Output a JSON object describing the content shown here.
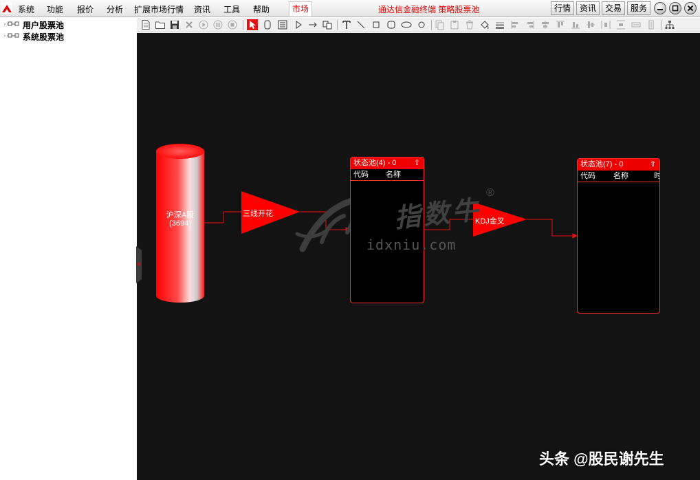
{
  "menu": {
    "items": [
      "系统",
      "功能",
      "报价",
      "分析",
      "扩展市场行情",
      "资讯",
      "工具",
      "帮助"
    ],
    "market_tab": "市场",
    "title": "通达信金融终端  策略股票池",
    "right_buttons": [
      "行情",
      "资讯",
      "交易",
      "服务"
    ]
  },
  "sidebar": {
    "tree": [
      {
        "label": "用户股票池"
      },
      {
        "label": "系统股票池"
      }
    ]
  },
  "toolbar": {
    "tools": [
      "new-file",
      "open-folder",
      "save",
      "delete",
      "play",
      "pause",
      "stop",
      "pointer",
      "capsule",
      "list",
      "triangle",
      "arrow",
      "copy",
      "text",
      "line",
      "rectangle",
      "rounded-rectangle",
      "ellipse",
      "circle",
      "copy-doc",
      "paste",
      "trash",
      "fill",
      "line-weight",
      "align-left",
      "align-right",
      "align-center-h",
      "align-top",
      "align-bottom",
      "align-middle-v",
      "distribute-h",
      "distribute-v",
      "same-width",
      "same-height",
      "tree-layout"
    ],
    "active_tool": "pointer"
  },
  "flow": {
    "source": {
      "name": "沪深A股",
      "count": "(3694)"
    },
    "filter1": {
      "label": "三线开花"
    },
    "pool1": {
      "title": "状态池(4) - 0",
      "up_icon": "arrow-up-icon",
      "columns": [
        "代码",
        "名称"
      ]
    },
    "filter2": {
      "label": "KDJ金叉"
    },
    "pool2": {
      "title": "状态池(7) - 0",
      "up_icon": "arrow-up-icon",
      "columns": [
        "代码",
        "名称",
        "时"
      ]
    }
  },
  "watermark": {
    "site": "idxniu.com",
    "brand": "指数牛",
    "reg": "®"
  },
  "source_tag": "头条 @股民谢先生",
  "colors": {
    "accent": "#ee0000",
    "canvas": "#131313",
    "menubar": "#ececec"
  }
}
